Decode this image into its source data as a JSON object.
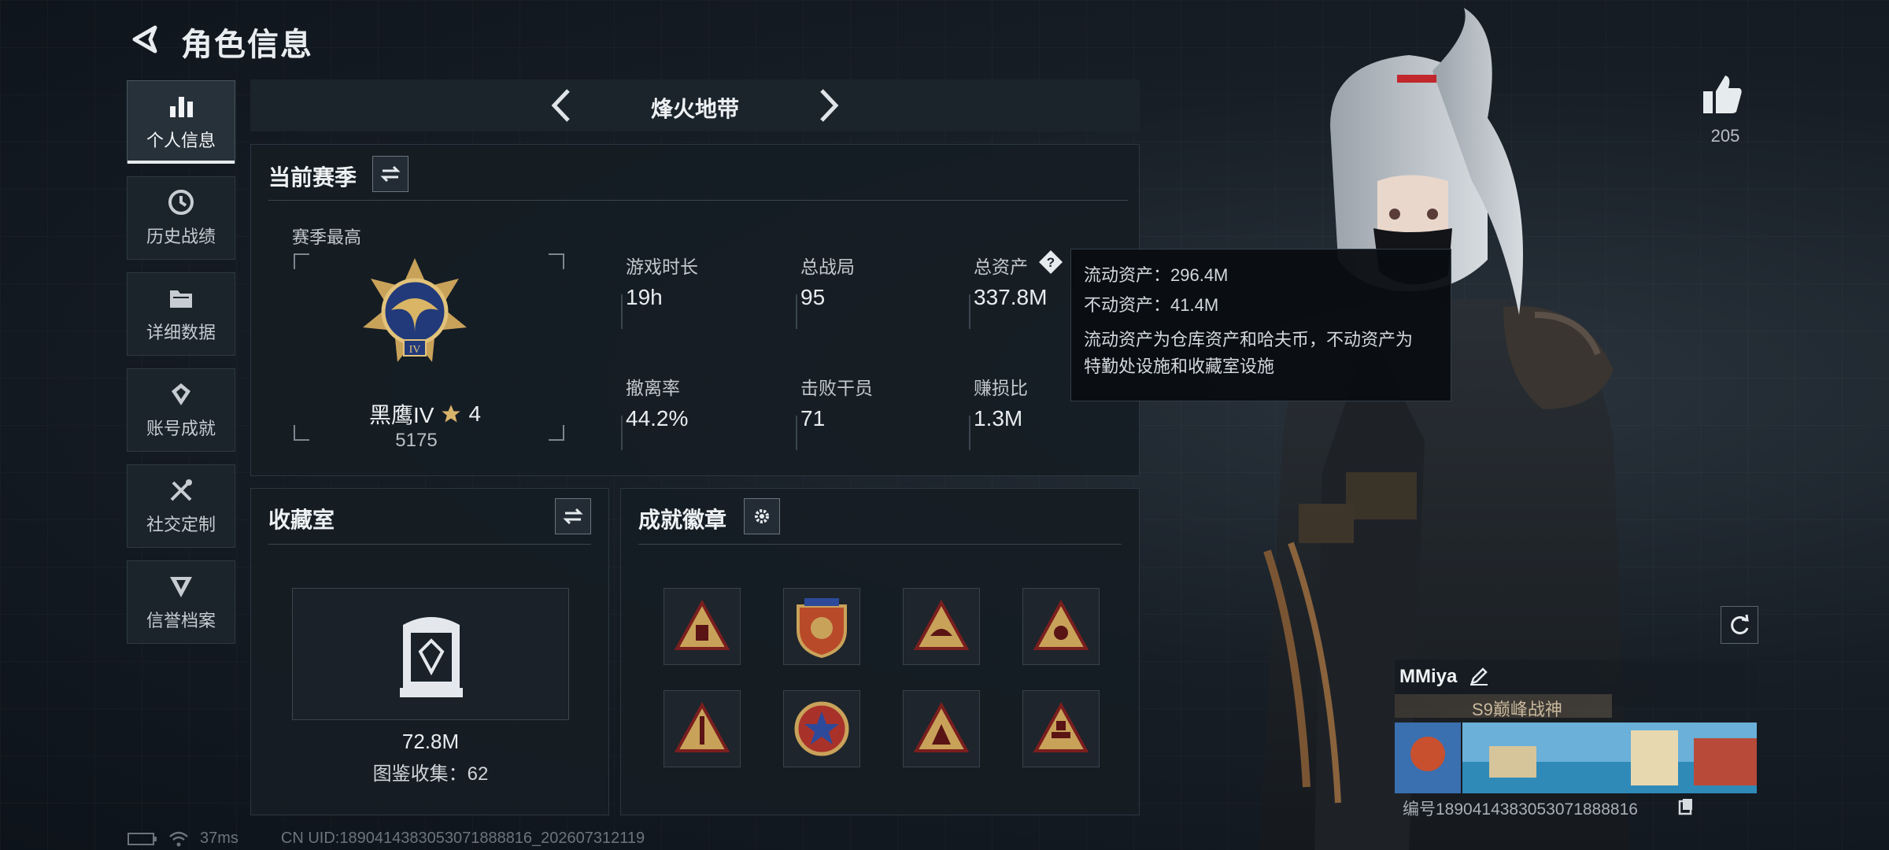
{
  "header": {
    "title": "角色信息",
    "back_icon": "back-arrow-icon"
  },
  "sidebar": {
    "items": [
      {
        "label": "个人信息",
        "icon": "bar-chart-icon",
        "active": true
      },
      {
        "label": "历史战绩",
        "icon": "clock-icon",
        "active": false
      },
      {
        "label": "详细数据",
        "icon": "folder-icon",
        "active": false
      },
      {
        "label": "账号成就",
        "icon": "achievement-icon",
        "active": false
      },
      {
        "label": "社交定制",
        "icon": "tools-icon",
        "active": false
      },
      {
        "label": "信誉档案",
        "icon": "shield-icon",
        "active": false
      }
    ]
  },
  "mode": {
    "name": "烽火地带"
  },
  "season": {
    "title": "当前赛季",
    "best_label": "赛季最高",
    "rank_name": "黑鹰IV",
    "rank_stars": "4",
    "rank_score": "5175",
    "stats": [
      {
        "label": "游戏时长",
        "value": "19h"
      },
      {
        "label": "总战局",
        "value": "95"
      },
      {
        "label": "总资产",
        "value": "337.8M"
      },
      {
        "label": "撤离率",
        "value": "44.2%"
      },
      {
        "label": "击败干员",
        "value": "71"
      },
      {
        "label": "赚损比",
        "value": "1.3M"
      }
    ]
  },
  "tooltip": {
    "line1": "流动资产：296.4M",
    "line2": "不动资产：41.4M",
    "line3": "流动资产为仓库资产和哈夫币，不动资产为",
    "line4": "特勤处设施和收藏室设施"
  },
  "collection": {
    "title": "收藏室",
    "value": "72.8M",
    "count_label": "图鉴收集：62"
  },
  "badges": {
    "title": "成就徽章",
    "items": [
      "badge-1",
      "badge-2",
      "badge-3",
      "badge-4",
      "badge-5",
      "badge-6",
      "badge-7",
      "badge-8"
    ]
  },
  "profile": {
    "likes": "205",
    "username": "MMiya",
    "title": "S9巅峰战神",
    "uid_line": "编号1890414383053071888816"
  },
  "status": {
    "ping": "37ms",
    "uid": "CN UID:1890414383053071888816_202607312119"
  },
  "colors": {
    "accent": "#e6ebee",
    "gold": "#c9a25a",
    "panel": "#161d24"
  }
}
